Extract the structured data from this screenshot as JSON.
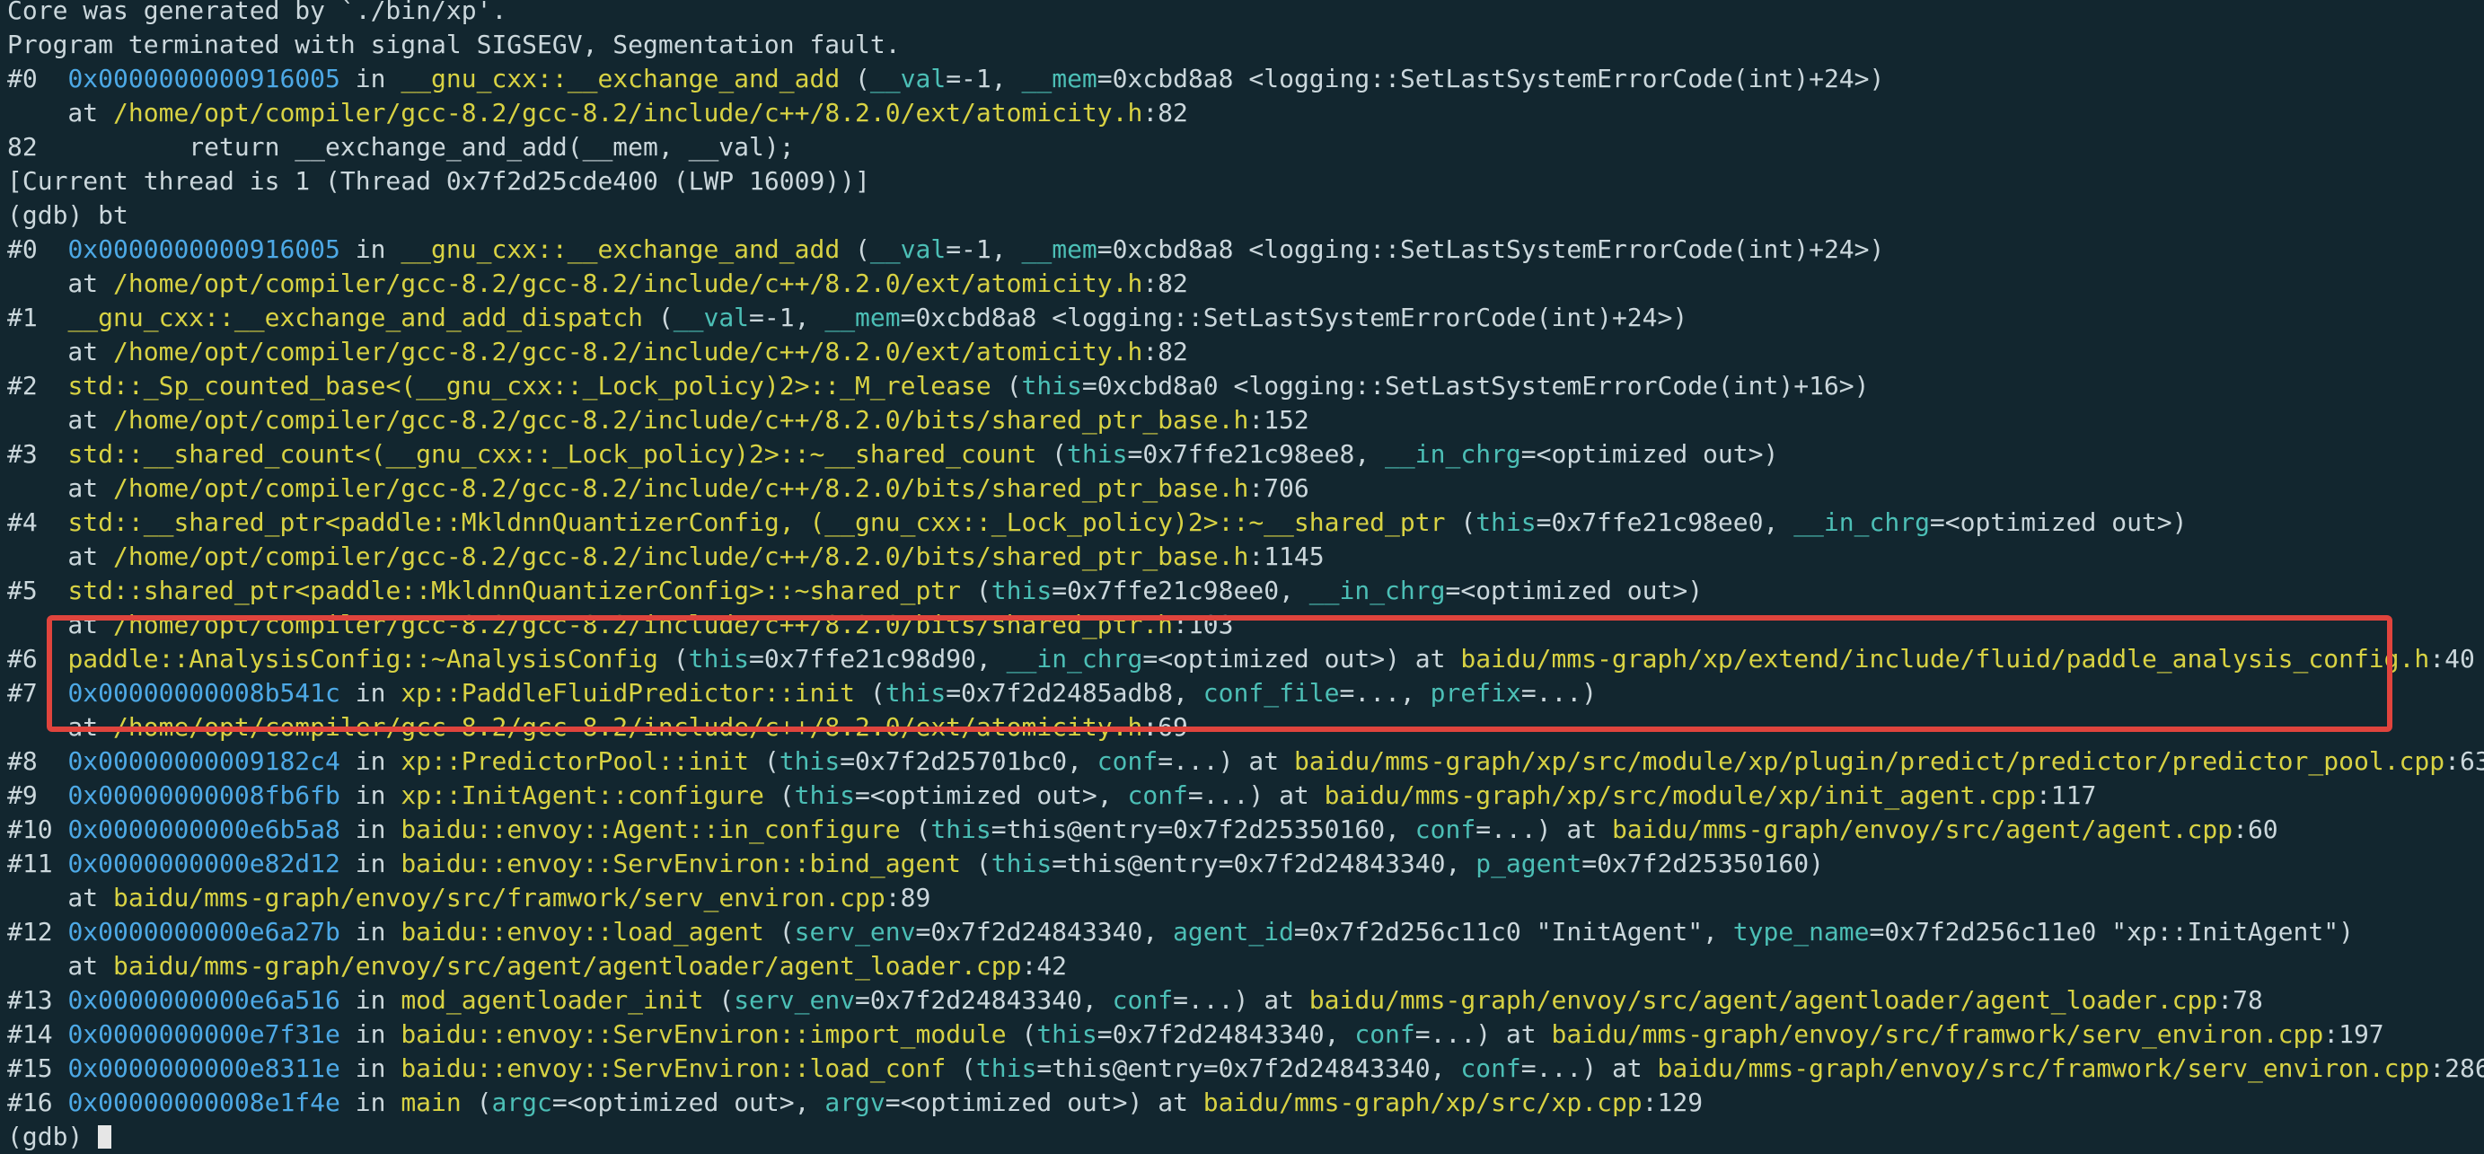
{
  "terminal": {
    "lines": [
      [
        {
          "t": "Core was generated by `./bin/xp'.",
          "c": "text"
        }
      ],
      [
        {
          "t": "Program terminated with signal SIGSEGV, Segmentation fault.",
          "c": "text"
        }
      ],
      [
        {
          "t": "#0  ",
          "c": "text"
        },
        {
          "t": "0x0000000000916005",
          "c": "addr"
        },
        {
          "t": " in ",
          "c": "text"
        },
        {
          "t": "__gnu_cxx::__exchange_and_add",
          "c": "func"
        },
        {
          "t": " (",
          "c": "text"
        },
        {
          "t": "__val",
          "c": "param"
        },
        {
          "t": "=-1, ",
          "c": "text"
        },
        {
          "t": "__mem",
          "c": "param"
        },
        {
          "t": "=0xcbd8a8 <logging::SetLastSystemErrorCode(int)+24>)",
          "c": "text"
        }
      ],
      [
        {
          "t": "    at ",
          "c": "text"
        },
        {
          "t": "/home/opt/compiler/gcc-8.2/gcc-8.2/include/c++/8.2.0/ext/atomicity.h",
          "c": "path"
        },
        {
          "t": ":82",
          "c": "text"
        }
      ],
      [
        {
          "t": "82          return __exchange_and_add(__mem, __val);",
          "c": "text"
        }
      ],
      [
        {
          "t": "[Current thread is 1 (Thread 0x7f2d25cde400 (LWP 16009))]",
          "c": "text"
        }
      ],
      [
        {
          "t": "(gdb) bt",
          "c": "text"
        }
      ],
      [
        {
          "t": "#0  ",
          "c": "text"
        },
        {
          "t": "0x0000000000916005",
          "c": "addr"
        },
        {
          "t": " in ",
          "c": "text"
        },
        {
          "t": "__gnu_cxx::__exchange_and_add",
          "c": "func"
        },
        {
          "t": " (",
          "c": "text"
        },
        {
          "t": "__val",
          "c": "param"
        },
        {
          "t": "=-1, ",
          "c": "text"
        },
        {
          "t": "__mem",
          "c": "param"
        },
        {
          "t": "=0xcbd8a8 <logging::SetLastSystemErrorCode(int)+24>)",
          "c": "text"
        }
      ],
      [
        {
          "t": "    at ",
          "c": "text"
        },
        {
          "t": "/home/opt/compiler/gcc-8.2/gcc-8.2/include/c++/8.2.0/ext/atomicity.h",
          "c": "path"
        },
        {
          "t": ":82",
          "c": "text"
        }
      ],
      [
        {
          "t": "#1  ",
          "c": "text"
        },
        {
          "t": "__gnu_cxx::__exchange_and_add_dispatch",
          "c": "func"
        },
        {
          "t": " (",
          "c": "text"
        },
        {
          "t": "__val",
          "c": "param"
        },
        {
          "t": "=-1, ",
          "c": "text"
        },
        {
          "t": "__mem",
          "c": "param"
        },
        {
          "t": "=0xcbd8a8 <logging::SetLastSystemErrorCode(int)+24>)",
          "c": "text"
        }
      ],
      [
        {
          "t": "    at ",
          "c": "text"
        },
        {
          "t": "/home/opt/compiler/gcc-8.2/gcc-8.2/include/c++/8.2.0/ext/atomicity.h",
          "c": "path"
        },
        {
          "t": ":82",
          "c": "text"
        }
      ],
      [
        {
          "t": "#2  ",
          "c": "text"
        },
        {
          "t": "std::_Sp_counted_base<(__gnu_cxx::_Lock_policy)2>::_M_release",
          "c": "func"
        },
        {
          "t": " (",
          "c": "text"
        },
        {
          "t": "this",
          "c": "param"
        },
        {
          "t": "=0xcbd8a0 <logging::SetLastSystemErrorCode(int)+16>)",
          "c": "text"
        }
      ],
      [
        {
          "t": "    at ",
          "c": "text"
        },
        {
          "t": "/home/opt/compiler/gcc-8.2/gcc-8.2/include/c++/8.2.0/bits/shared_ptr_base.h",
          "c": "path"
        },
        {
          "t": ":152",
          "c": "text"
        }
      ],
      [
        {
          "t": "#3  ",
          "c": "text"
        },
        {
          "t": "std::__shared_count<(__gnu_cxx::_Lock_policy)2>::~__shared_count",
          "c": "func"
        },
        {
          "t": " (",
          "c": "text"
        },
        {
          "t": "this",
          "c": "param"
        },
        {
          "t": "=0x7ffe21c98ee8, ",
          "c": "text"
        },
        {
          "t": "__in_chrg",
          "c": "param"
        },
        {
          "t": "=<optimized out>)",
          "c": "text"
        }
      ],
      [
        {
          "t": "    at ",
          "c": "text"
        },
        {
          "t": "/home/opt/compiler/gcc-8.2/gcc-8.2/include/c++/8.2.0/bits/shared_ptr_base.h",
          "c": "path"
        },
        {
          "t": ":706",
          "c": "text"
        }
      ],
      [
        {
          "t": "#4  ",
          "c": "text"
        },
        {
          "t": "std::__shared_ptr<paddle::MkldnnQuantizerConfig, (__gnu_cxx::_Lock_policy)2>::~__shared_ptr",
          "c": "func"
        },
        {
          "t": " (",
          "c": "text"
        },
        {
          "t": "this",
          "c": "param"
        },
        {
          "t": "=0x7ffe21c98ee0, ",
          "c": "text"
        },
        {
          "t": "__in_chrg",
          "c": "param"
        },
        {
          "t": "=<optimized out>)",
          "c": "text"
        }
      ],
      [
        {
          "t": "    at ",
          "c": "text"
        },
        {
          "t": "/home/opt/compiler/gcc-8.2/gcc-8.2/include/c++/8.2.0/bits/shared_ptr_base.h",
          "c": "path"
        },
        {
          "t": ":1145",
          "c": "text"
        }
      ],
      [
        {
          "t": "#5  ",
          "c": "text"
        },
        {
          "t": "std::shared_ptr<paddle::MkldnnQuantizerConfig>::~shared_ptr",
          "c": "func"
        },
        {
          "t": " (",
          "c": "text"
        },
        {
          "t": "this",
          "c": "param"
        },
        {
          "t": "=0x7ffe21c98ee0, ",
          "c": "text"
        },
        {
          "t": "__in_chrg",
          "c": "param"
        },
        {
          "t": "=<optimized out>)",
          "c": "text"
        }
      ],
      [
        {
          "t": "    at ",
          "c": "text"
        },
        {
          "t": "/home/opt/compiler/gcc-8.2/gcc-8.2/include/c++/8.2.0/bits/shared_ptr.h",
          "c": "path"
        },
        {
          "t": ":103",
          "c": "text"
        }
      ],
      [
        {
          "t": "#6  ",
          "c": "text"
        },
        {
          "t": "paddle::AnalysisConfig::~AnalysisConfig",
          "c": "func"
        },
        {
          "t": " (",
          "c": "text"
        },
        {
          "t": "this",
          "c": "param"
        },
        {
          "t": "=0x7ffe21c98d90, ",
          "c": "text"
        },
        {
          "t": "__in_chrg",
          "c": "param"
        },
        {
          "t": "=<optimized out>) at ",
          "c": "text"
        },
        {
          "t": "baidu/mms-graph/xp/extend/include/fluid/paddle_analysis_config.h",
          "c": "path"
        },
        {
          "t": ":40",
          "c": "text"
        }
      ],
      [
        {
          "t": "#7  ",
          "c": "text"
        },
        {
          "t": "0x00000000008b541c",
          "c": "addr"
        },
        {
          "t": " in ",
          "c": "text"
        },
        {
          "t": "xp::PaddleFluidPredictor::init",
          "c": "func"
        },
        {
          "t": " (",
          "c": "text"
        },
        {
          "t": "this",
          "c": "param"
        },
        {
          "t": "=0x7f2d2485adb8, ",
          "c": "text"
        },
        {
          "t": "conf_file",
          "c": "param"
        },
        {
          "t": "=..., ",
          "c": "text"
        },
        {
          "t": "prefix",
          "c": "param"
        },
        {
          "t": "=...)",
          "c": "text"
        }
      ],
      [
        {
          "t": "    at ",
          "c": "text"
        },
        {
          "t": "/home/opt/compiler/gcc-8.2/gcc-8.2/include/c++/8.2.0/ext/atomicity.h",
          "c": "path"
        },
        {
          "t": ":69",
          "c": "text"
        }
      ],
      [
        {
          "t": "#8  ",
          "c": "text"
        },
        {
          "t": "0x00000000009182c4",
          "c": "addr"
        },
        {
          "t": " in ",
          "c": "text"
        },
        {
          "t": "xp::PredictorPool::init",
          "c": "func"
        },
        {
          "t": " (",
          "c": "text"
        },
        {
          "t": "this",
          "c": "param"
        },
        {
          "t": "=0x7f2d25701bc0, ",
          "c": "text"
        },
        {
          "t": "conf",
          "c": "param"
        },
        {
          "t": "=...) at ",
          "c": "text"
        },
        {
          "t": "baidu/mms-graph/xp/src/module/xp/plugin/predict/predictor/predictor_pool.cpp",
          "c": "path"
        },
        {
          "t": ":63",
          "c": "text"
        }
      ],
      [
        {
          "t": "#9  ",
          "c": "text"
        },
        {
          "t": "0x00000000008fb6fb",
          "c": "addr"
        },
        {
          "t": " in ",
          "c": "text"
        },
        {
          "t": "xp::InitAgent::configure",
          "c": "func"
        },
        {
          "t": " (",
          "c": "text"
        },
        {
          "t": "this",
          "c": "param"
        },
        {
          "t": "=<optimized out>, ",
          "c": "text"
        },
        {
          "t": "conf",
          "c": "param"
        },
        {
          "t": "=...) at ",
          "c": "text"
        },
        {
          "t": "baidu/mms-graph/xp/src/module/xp/init_agent.cpp",
          "c": "path"
        },
        {
          "t": ":117",
          "c": "text"
        }
      ],
      [
        {
          "t": "#10 ",
          "c": "text"
        },
        {
          "t": "0x0000000000e6b5a8",
          "c": "addr"
        },
        {
          "t": " in ",
          "c": "text"
        },
        {
          "t": "baidu::envoy::Agent::in_configure",
          "c": "func"
        },
        {
          "t": " (",
          "c": "text"
        },
        {
          "t": "this",
          "c": "param"
        },
        {
          "t": "=this@entry=0x7f2d25350160, ",
          "c": "text"
        },
        {
          "t": "conf",
          "c": "param"
        },
        {
          "t": "=...) at ",
          "c": "text"
        },
        {
          "t": "baidu/mms-graph/envoy/src/agent/agent.cpp",
          "c": "path"
        },
        {
          "t": ":60",
          "c": "text"
        }
      ],
      [
        {
          "t": "#11 ",
          "c": "text"
        },
        {
          "t": "0x0000000000e82d12",
          "c": "addr"
        },
        {
          "t": " in ",
          "c": "text"
        },
        {
          "t": "baidu::envoy::ServEnviron::bind_agent",
          "c": "func"
        },
        {
          "t": " (",
          "c": "text"
        },
        {
          "t": "this",
          "c": "param"
        },
        {
          "t": "=this@entry=0x7f2d24843340, ",
          "c": "text"
        },
        {
          "t": "p_agent",
          "c": "param"
        },
        {
          "t": "=0x7f2d25350160)",
          "c": "text"
        }
      ],
      [
        {
          "t": "    at ",
          "c": "text"
        },
        {
          "t": "baidu/mms-graph/envoy/src/framwork/serv_environ.cpp",
          "c": "path"
        },
        {
          "t": ":89",
          "c": "text"
        }
      ],
      [
        {
          "t": "#12 ",
          "c": "text"
        },
        {
          "t": "0x0000000000e6a27b",
          "c": "addr"
        },
        {
          "t": " in ",
          "c": "text"
        },
        {
          "t": "baidu::envoy::load_agent",
          "c": "func"
        },
        {
          "t": " (",
          "c": "text"
        },
        {
          "t": "serv_env",
          "c": "param"
        },
        {
          "t": "=0x7f2d24843340, ",
          "c": "text"
        },
        {
          "t": "agent_id",
          "c": "param"
        },
        {
          "t": "=0x7f2d256c11c0 \"InitAgent\", ",
          "c": "text"
        },
        {
          "t": "type_name",
          "c": "param"
        },
        {
          "t": "=0x7f2d256c11e0 \"xp::InitAgent\")",
          "c": "text"
        }
      ],
      [
        {
          "t": "    at ",
          "c": "text"
        },
        {
          "t": "baidu/mms-graph/envoy/src/agent/agentloader/agent_loader.cpp",
          "c": "path"
        },
        {
          "t": ":42",
          "c": "text"
        }
      ],
      [
        {
          "t": "#13 ",
          "c": "text"
        },
        {
          "t": "0x0000000000e6a516",
          "c": "addr"
        },
        {
          "t": " in ",
          "c": "text"
        },
        {
          "t": "mod_agentloader_init",
          "c": "func"
        },
        {
          "t": " (",
          "c": "text"
        },
        {
          "t": "serv_env",
          "c": "param"
        },
        {
          "t": "=0x7f2d24843340, ",
          "c": "text"
        },
        {
          "t": "conf",
          "c": "param"
        },
        {
          "t": "=...) at ",
          "c": "text"
        },
        {
          "t": "baidu/mms-graph/envoy/src/agent/agentloader/agent_loader.cpp",
          "c": "path"
        },
        {
          "t": ":78",
          "c": "text"
        }
      ],
      [
        {
          "t": "#14 ",
          "c": "text"
        },
        {
          "t": "0x0000000000e7f31e",
          "c": "addr"
        },
        {
          "t": " in ",
          "c": "text"
        },
        {
          "t": "baidu::envoy::ServEnviron::import_module",
          "c": "func"
        },
        {
          "t": " (",
          "c": "text"
        },
        {
          "t": "this",
          "c": "param"
        },
        {
          "t": "=0x7f2d24843340, ",
          "c": "text"
        },
        {
          "t": "conf",
          "c": "param"
        },
        {
          "t": "=...) at ",
          "c": "text"
        },
        {
          "t": "baidu/mms-graph/envoy/src/framwork/serv_environ.cpp",
          "c": "path"
        },
        {
          "t": ":197",
          "c": "text"
        }
      ],
      [
        {
          "t": "#15 ",
          "c": "text"
        },
        {
          "t": "0x0000000000e8311e",
          "c": "addr"
        },
        {
          "t": " in ",
          "c": "text"
        },
        {
          "t": "baidu::envoy::ServEnviron::load_conf",
          "c": "func"
        },
        {
          "t": " (",
          "c": "text"
        },
        {
          "t": "this",
          "c": "param"
        },
        {
          "t": "=this@entry=0x7f2d24843340, ",
          "c": "text"
        },
        {
          "t": "conf",
          "c": "param"
        },
        {
          "t": "=...) at ",
          "c": "text"
        },
        {
          "t": "baidu/mms-graph/envoy/src/framwork/serv_environ.cpp",
          "c": "path"
        },
        {
          "t": ":286",
          "c": "text"
        }
      ],
      [
        {
          "t": "#16 ",
          "c": "text"
        },
        {
          "t": "0x00000000008e1f4e",
          "c": "addr"
        },
        {
          "t": " in ",
          "c": "text"
        },
        {
          "t": "main",
          "c": "func"
        },
        {
          "t": " (",
          "c": "text"
        },
        {
          "t": "argc",
          "c": "param"
        },
        {
          "t": "=<optimized out>, ",
          "c": "text"
        },
        {
          "t": "argv",
          "c": "param"
        },
        {
          "t": "=<optimized out>) at ",
          "c": "text"
        },
        {
          "t": "baidu/mms-graph/xp/src/xp.cpp",
          "c": "path"
        },
        {
          "t": ":129",
          "c": "text"
        }
      ],
      [
        {
          "t": "(gdb) ",
          "c": "text"
        }
      ]
    ],
    "colors": {
      "background": "#12262f",
      "text": "#cbd7dc",
      "address": "#4da9e6",
      "function": "#d8d243",
      "parameter": "#4cbfb6",
      "highlight_border": "#e0443d"
    }
  }
}
